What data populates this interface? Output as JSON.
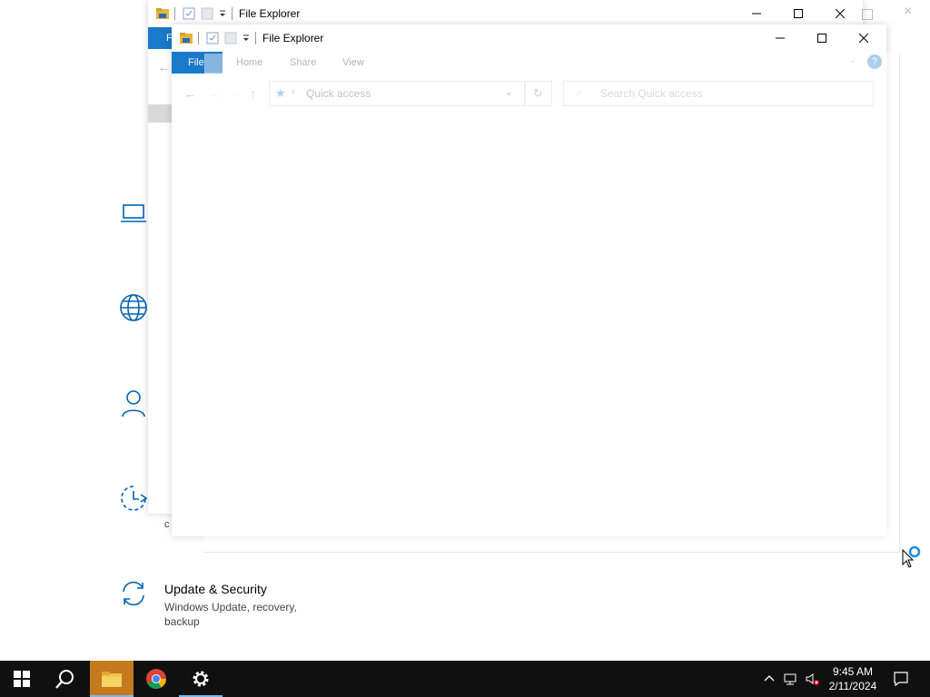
{
  "settings": {
    "update_title": "Update & Security",
    "update_desc": "Windows Update, recovery, backup",
    "partial_text_1": "c"
  },
  "explorer_back": {
    "title": "File Explorer",
    "file_tab_partial": "F"
  },
  "explorer_front": {
    "title": "File Explorer",
    "tabs": {
      "file": "File",
      "home": "Home",
      "share": "Share",
      "view": "View"
    },
    "address": "Quick access",
    "search_placeholder": "Search Quick access"
  },
  "taskbar": {
    "time": "9:45 AM",
    "date": "2/11/2024"
  },
  "colors": {
    "accent": "#1979ca",
    "settings_icon": "#0063b1",
    "taskbar": "#101010"
  }
}
